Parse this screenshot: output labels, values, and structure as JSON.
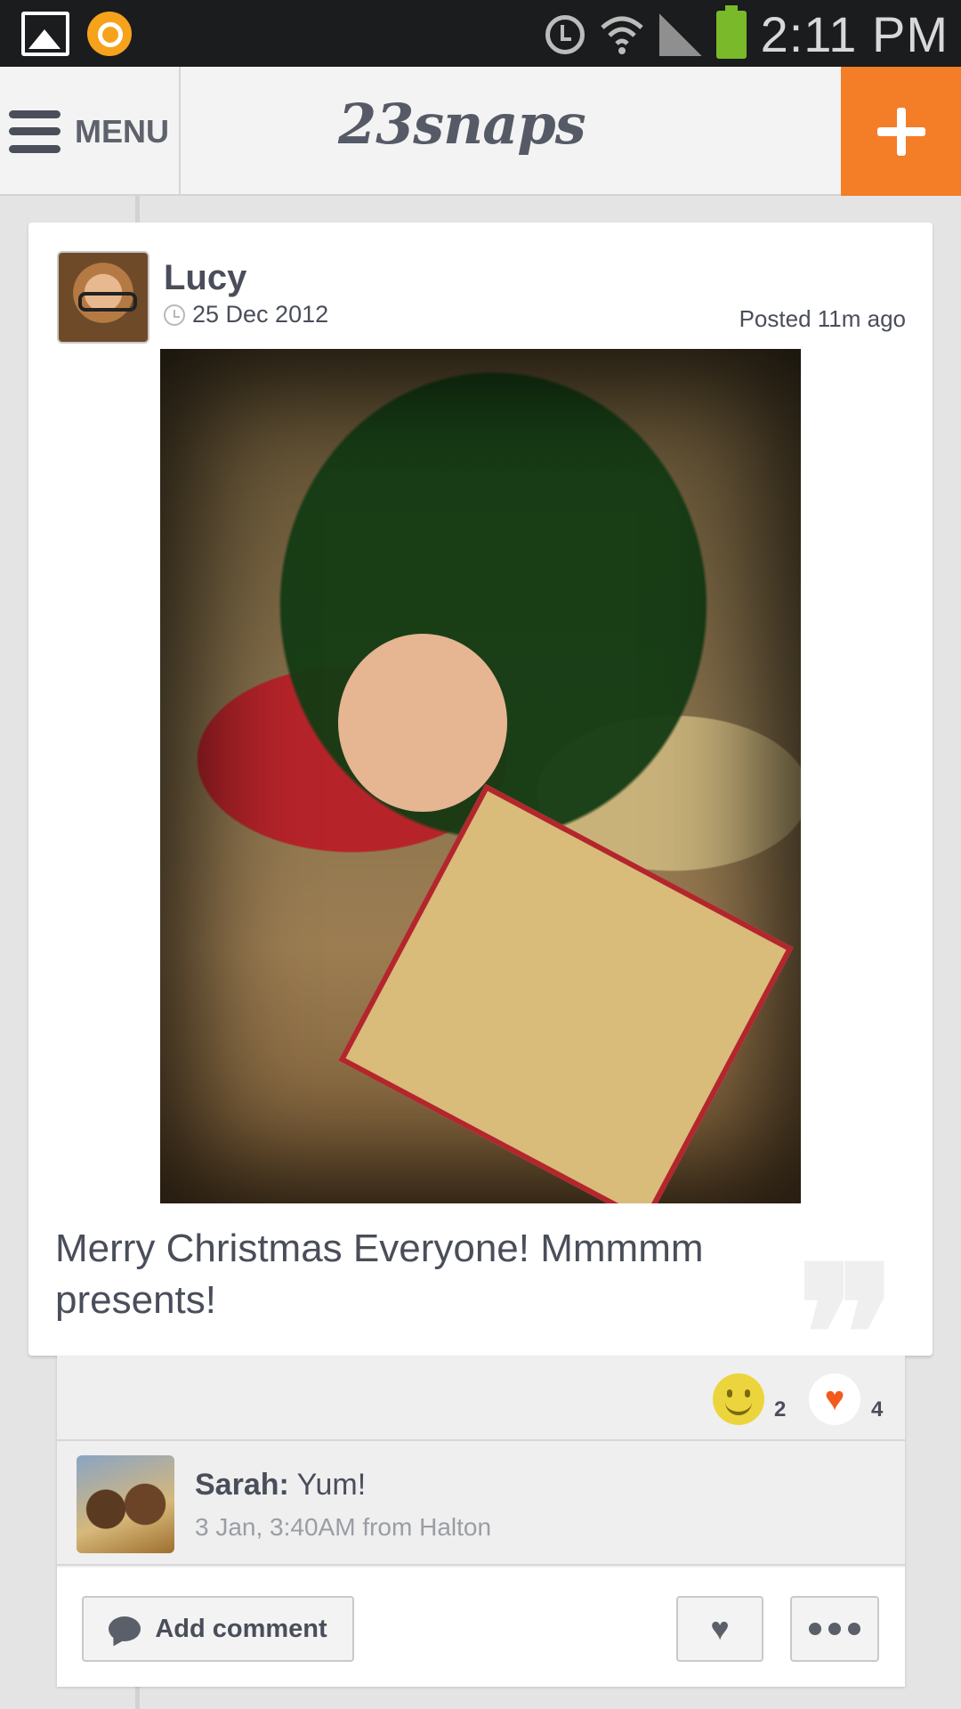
{
  "status_bar": {
    "time": "2:11 PM",
    "icons": [
      "gallery-icon",
      "avast-icon",
      "alarm-icon",
      "wifi-icon",
      "signal-icon",
      "battery-icon"
    ]
  },
  "app_bar": {
    "menu_label": "MENU",
    "logo": "23snaps",
    "accent_color": "#f47d28"
  },
  "post": {
    "author": "Lucy",
    "date": "25 Dec 2012",
    "posted": "Posted 11m ago",
    "caption": "Merry Christmas Everyone! Mmmmm presents!",
    "reactions": {
      "smile_count": "2",
      "heart_count": "4"
    }
  },
  "comments": [
    {
      "author": "Sarah:",
      "text": " Yum!",
      "meta": "3 Jan, 3:40AM from Halton"
    }
  ],
  "actions": {
    "add_comment_label": "Add comment"
  }
}
